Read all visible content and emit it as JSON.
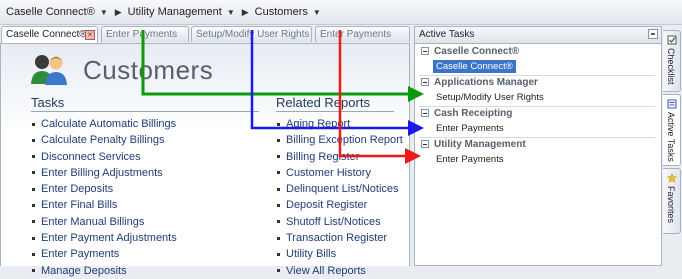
{
  "breadcrumb": {
    "items": [
      {
        "label": "Caselle Connect®"
      },
      {
        "label": "Utility Management"
      },
      {
        "label": "Customers"
      }
    ]
  },
  "tabs": [
    {
      "label": "Caselle Connect®",
      "active": true
    },
    {
      "label": "Enter Payments",
      "active": false
    },
    {
      "label": "Setup/Modify User Rights",
      "active": false
    },
    {
      "label": "Enter Payments",
      "active": false
    }
  ],
  "page": {
    "title": "Customers",
    "icon": "users-icon"
  },
  "tasks": {
    "heading": "Tasks",
    "items": [
      "Calculate Automatic Billings",
      "Calculate Penalty Billings",
      "Disconnect Services",
      "Enter Billing Adjustments",
      "Enter Deposits",
      "Enter Final Bills",
      "Enter Manual Billings",
      "Enter Payment Adjustments",
      "Enter Payments",
      "Manage Deposits"
    ]
  },
  "reports": {
    "heading": "Related Reports",
    "items": [
      "Aging Report",
      "Billing Exception Report",
      "Billing Register",
      "Customer History",
      "Delinquent List/Notices",
      "Deposit Register",
      "Shutoff List/Notices",
      "Transaction Register",
      "Utility Bills",
      "View All Reports"
    ]
  },
  "active_tasks": {
    "title": "Active Tasks",
    "groups": [
      {
        "label": "Caselle Connect®",
        "items": [
          {
            "label": "Caselle Connect®",
            "selected": true
          }
        ]
      },
      {
        "label": "Applications Manager",
        "items": [
          {
            "label": "Setup/Modify User Rights",
            "selected": false
          }
        ]
      },
      {
        "label": "Cash Receipting",
        "items": [
          {
            "label": "Enter Payments",
            "selected": false
          }
        ]
      },
      {
        "label": "Utility Management",
        "items": [
          {
            "label": "Enter Payments",
            "selected": false
          }
        ]
      }
    ]
  },
  "side_tabs": [
    {
      "label": "Checklist",
      "icon": "checklist-icon"
    },
    {
      "label": "Active Tasks",
      "icon": "active-tasks-icon"
    },
    {
      "label": "Favorites",
      "icon": "star-icon"
    }
  ],
  "colors": {
    "arrow_green": "#0a9a0a",
    "arrow_blue": "#1a1aee",
    "arrow_red": "#ee1a1a",
    "selected": "#3c74c9",
    "link": "#1f3d7a"
  }
}
